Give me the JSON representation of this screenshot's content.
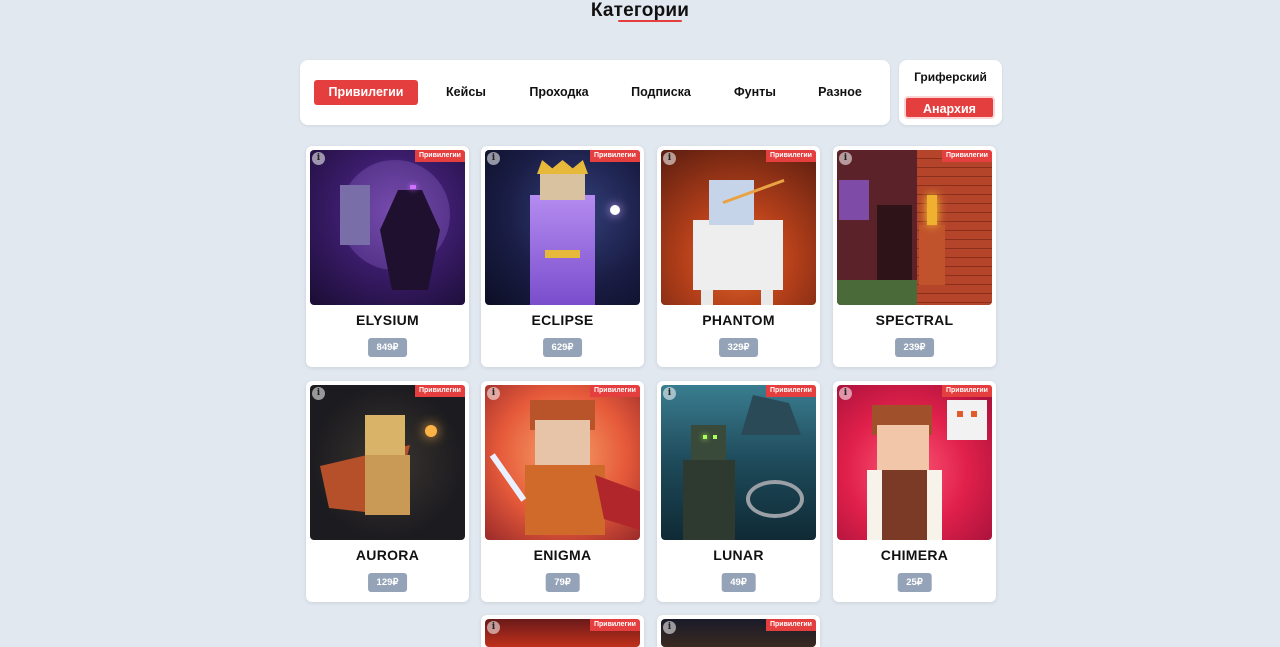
{
  "page": {
    "title": "Категории"
  },
  "categories": {
    "items": [
      {
        "label": "Привилегии",
        "active": true
      },
      {
        "label": "Кейсы",
        "active": false
      },
      {
        "label": "Проходка",
        "active": false
      },
      {
        "label": "Подписка",
        "active": false
      },
      {
        "label": "Фунты",
        "active": false
      },
      {
        "label": "Разное",
        "active": false
      }
    ]
  },
  "server": {
    "label": "Гриферский",
    "selected": "Анархия"
  },
  "products": [
    {
      "name": "ELYSIUM",
      "price": "849₽",
      "badge": "Привилегии",
      "icon": "info-icon"
    },
    {
      "name": "ECLIPSE",
      "price": "629₽",
      "badge": "Привилегии",
      "icon": "info-icon"
    },
    {
      "name": "PHANTOM",
      "price": "329₽",
      "badge": "Привилегии",
      "icon": "info-icon"
    },
    {
      "name": "SPECTRAL",
      "price": "239₽",
      "badge": "Привилегии",
      "icon": "info-icon"
    },
    {
      "name": "AURORA",
      "price": "129₽",
      "badge": "Привилегии",
      "icon": "info-icon"
    },
    {
      "name": "ENIGMA",
      "price": "79₽",
      "badge": "Привилегии",
      "icon": "info-icon"
    },
    {
      "name": "LUNAR",
      "price": "49₽",
      "badge": "Привилегии",
      "icon": "info-icon"
    },
    {
      "name": "CHIMERA",
      "price": "25₽",
      "badge": "Привилегии",
      "icon": "info-icon"
    },
    {
      "badge": "Привилегии",
      "icon": "info-icon"
    },
    {
      "badge": "Привилегии",
      "icon": "info-icon"
    }
  ],
  "colors": {
    "accent": "#e53e3e",
    "background": "#e2e8f0",
    "price_bg": "#94a3b8"
  }
}
